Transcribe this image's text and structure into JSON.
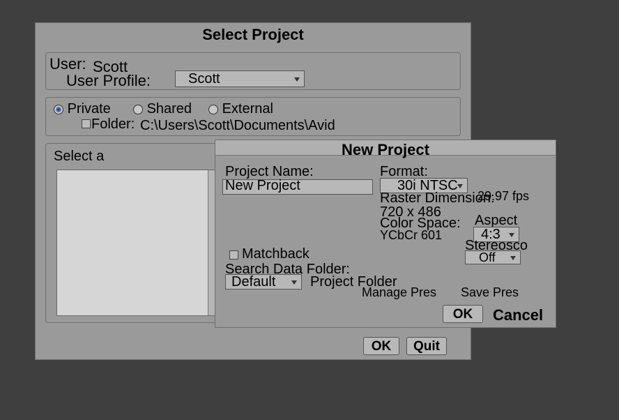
{
  "select_project": {
    "title": "Select Project",
    "user_label": "User:",
    "user_value_ghost": "Scott",
    "user_profile_label": "User Profile:",
    "user_profile_value": "Scott",
    "radios": {
      "private": "Private",
      "shared": "Shared",
      "external": "External"
    },
    "folder_label": "Folder:",
    "folder_path_ghost": "C:\\Users\\Scott\\Documents\\Avid",
    "select_a_label": "Select a",
    "ok": "OK",
    "quit": "Quit"
  },
  "new_project": {
    "title": "New Project",
    "project_name_label": "Project Name:",
    "project_name_ghost": "New Project",
    "format_label": "Format:",
    "format_value": "30i NTSC",
    "raster_dim_label": "Raster Dimension:",
    "raster_dim_value": "720 x 486",
    "color_space_label": "Color Space:",
    "color_space_value_ghost": "YCbCr 601",
    "aspect_label": "Aspect",
    "aspect_value": "4:3",
    "stereo_label": "Stereosco",
    "stereo_value_ghost": "Off",
    "matchback_label": "Matchback",
    "search_data_label": "Search Data Folder:",
    "search_data_select": "Default",
    "project_folder_ghost": "Project Folder",
    "manage_pres_ghost": "Manage Pres",
    "save_pres_ghost": "Save Pres",
    "fps_ghost": "29.97 fps",
    "ok": "OK",
    "cancel_ghost": "Cancel"
  }
}
